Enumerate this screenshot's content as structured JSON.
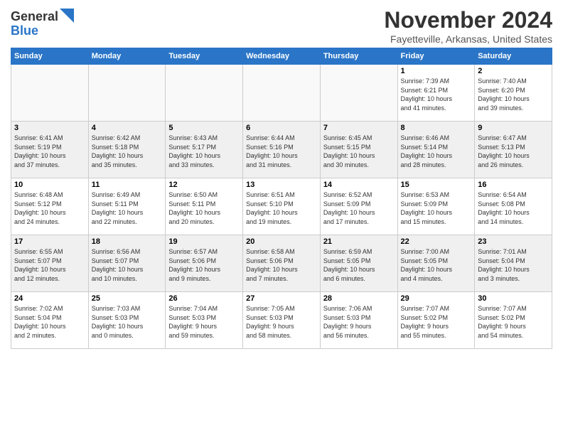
{
  "header": {
    "logo_line1": "General",
    "logo_line2": "Blue",
    "month_title": "November 2024",
    "location": "Fayetteville, Arkansas, United States"
  },
  "weekdays": [
    "Sunday",
    "Monday",
    "Tuesday",
    "Wednesday",
    "Thursday",
    "Friday",
    "Saturday"
  ],
  "weeks": [
    [
      {
        "day": "",
        "content": "",
        "empty": true
      },
      {
        "day": "",
        "content": "",
        "empty": true
      },
      {
        "day": "",
        "content": "",
        "empty": true
      },
      {
        "day": "",
        "content": "",
        "empty": true
      },
      {
        "day": "",
        "content": "",
        "empty": true
      },
      {
        "day": "1",
        "content": "Sunrise: 7:39 AM\nSunset: 6:21 PM\nDaylight: 10 hours\nand 41 minutes."
      },
      {
        "day": "2",
        "content": "Sunrise: 7:40 AM\nSunset: 6:20 PM\nDaylight: 10 hours\nand 39 minutes."
      }
    ],
    [
      {
        "day": "3",
        "content": "Sunrise: 6:41 AM\nSunset: 5:19 PM\nDaylight: 10 hours\nand 37 minutes.",
        "shaded": true
      },
      {
        "day": "4",
        "content": "Sunrise: 6:42 AM\nSunset: 5:18 PM\nDaylight: 10 hours\nand 35 minutes.",
        "shaded": true
      },
      {
        "day": "5",
        "content": "Sunrise: 6:43 AM\nSunset: 5:17 PM\nDaylight: 10 hours\nand 33 minutes.",
        "shaded": true
      },
      {
        "day": "6",
        "content": "Sunrise: 6:44 AM\nSunset: 5:16 PM\nDaylight: 10 hours\nand 31 minutes.",
        "shaded": true
      },
      {
        "day": "7",
        "content": "Sunrise: 6:45 AM\nSunset: 5:15 PM\nDaylight: 10 hours\nand 30 minutes.",
        "shaded": true
      },
      {
        "day": "8",
        "content": "Sunrise: 6:46 AM\nSunset: 5:14 PM\nDaylight: 10 hours\nand 28 minutes.",
        "shaded": true
      },
      {
        "day": "9",
        "content": "Sunrise: 6:47 AM\nSunset: 5:13 PM\nDaylight: 10 hours\nand 26 minutes.",
        "shaded": true
      }
    ],
    [
      {
        "day": "10",
        "content": "Sunrise: 6:48 AM\nSunset: 5:12 PM\nDaylight: 10 hours\nand 24 minutes."
      },
      {
        "day": "11",
        "content": "Sunrise: 6:49 AM\nSunset: 5:11 PM\nDaylight: 10 hours\nand 22 minutes."
      },
      {
        "day": "12",
        "content": "Sunrise: 6:50 AM\nSunset: 5:11 PM\nDaylight: 10 hours\nand 20 minutes."
      },
      {
        "day": "13",
        "content": "Sunrise: 6:51 AM\nSunset: 5:10 PM\nDaylight: 10 hours\nand 19 minutes."
      },
      {
        "day": "14",
        "content": "Sunrise: 6:52 AM\nSunset: 5:09 PM\nDaylight: 10 hours\nand 17 minutes."
      },
      {
        "day": "15",
        "content": "Sunrise: 6:53 AM\nSunset: 5:09 PM\nDaylight: 10 hours\nand 15 minutes."
      },
      {
        "day": "16",
        "content": "Sunrise: 6:54 AM\nSunset: 5:08 PM\nDaylight: 10 hours\nand 14 minutes."
      }
    ],
    [
      {
        "day": "17",
        "content": "Sunrise: 6:55 AM\nSunset: 5:07 PM\nDaylight: 10 hours\nand 12 minutes.",
        "shaded": true
      },
      {
        "day": "18",
        "content": "Sunrise: 6:56 AM\nSunset: 5:07 PM\nDaylight: 10 hours\nand 10 minutes.",
        "shaded": true
      },
      {
        "day": "19",
        "content": "Sunrise: 6:57 AM\nSunset: 5:06 PM\nDaylight: 10 hours\nand 9 minutes.",
        "shaded": true
      },
      {
        "day": "20",
        "content": "Sunrise: 6:58 AM\nSunset: 5:06 PM\nDaylight: 10 hours\nand 7 minutes.",
        "shaded": true
      },
      {
        "day": "21",
        "content": "Sunrise: 6:59 AM\nSunset: 5:05 PM\nDaylight: 10 hours\nand 6 minutes.",
        "shaded": true
      },
      {
        "day": "22",
        "content": "Sunrise: 7:00 AM\nSunset: 5:05 PM\nDaylight: 10 hours\nand 4 minutes.",
        "shaded": true
      },
      {
        "day": "23",
        "content": "Sunrise: 7:01 AM\nSunset: 5:04 PM\nDaylight: 10 hours\nand 3 minutes.",
        "shaded": true
      }
    ],
    [
      {
        "day": "24",
        "content": "Sunrise: 7:02 AM\nSunset: 5:04 PM\nDaylight: 10 hours\nand 2 minutes."
      },
      {
        "day": "25",
        "content": "Sunrise: 7:03 AM\nSunset: 5:03 PM\nDaylight: 10 hours\nand 0 minutes."
      },
      {
        "day": "26",
        "content": "Sunrise: 7:04 AM\nSunset: 5:03 PM\nDaylight: 9 hours\nand 59 minutes."
      },
      {
        "day": "27",
        "content": "Sunrise: 7:05 AM\nSunset: 5:03 PM\nDaylight: 9 hours\nand 58 minutes."
      },
      {
        "day": "28",
        "content": "Sunrise: 7:06 AM\nSunset: 5:03 PM\nDaylight: 9 hours\nand 56 minutes."
      },
      {
        "day": "29",
        "content": "Sunrise: 7:07 AM\nSunset: 5:02 PM\nDaylight: 9 hours\nand 55 minutes."
      },
      {
        "day": "30",
        "content": "Sunrise: 7:07 AM\nSunset: 5:02 PM\nDaylight: 9 hours\nand 54 minutes."
      }
    ]
  ]
}
